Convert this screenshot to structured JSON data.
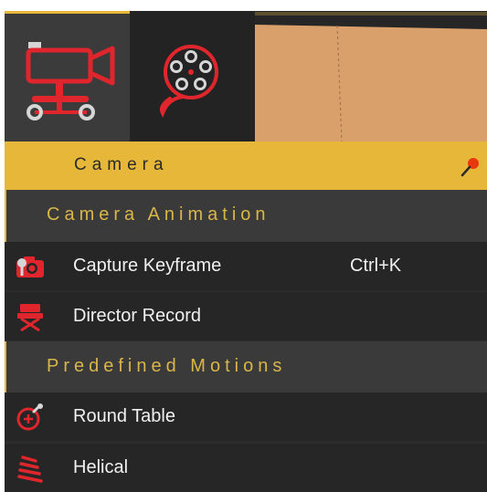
{
  "toolbar": {
    "tools": [
      {
        "name": "camera-tool",
        "icon": "video-camera-on-dolly-icon",
        "active": true
      },
      {
        "name": "film-reel-tool",
        "icon": "film-reel-icon",
        "active": false
      }
    ]
  },
  "panel": {
    "title": "Camera",
    "pin_icon": "pin-icon",
    "sections": [
      {
        "title": "Camera Animation",
        "items": [
          {
            "label": "Capture Keyframe",
            "shortcut": "Ctrl+K",
            "icon": "camera-capture-icon"
          },
          {
            "label": "Director Record",
            "shortcut": "",
            "icon": "director-chair-icon"
          }
        ]
      },
      {
        "title": "Predefined Motions",
        "items": [
          {
            "label": "Round Table",
            "shortcut": "",
            "icon": "round-table-icon"
          },
          {
            "label": "Helical",
            "shortcut": "",
            "icon": "helix-icon"
          }
        ]
      }
    ]
  },
  "colors": {
    "accent": "#e6b739",
    "icon_red": "#e0262c",
    "section_text": "#d9b648",
    "item_text": "#f0f0f0",
    "background": "#2c2c2c",
    "viewport_surface": "#d9a06b"
  }
}
